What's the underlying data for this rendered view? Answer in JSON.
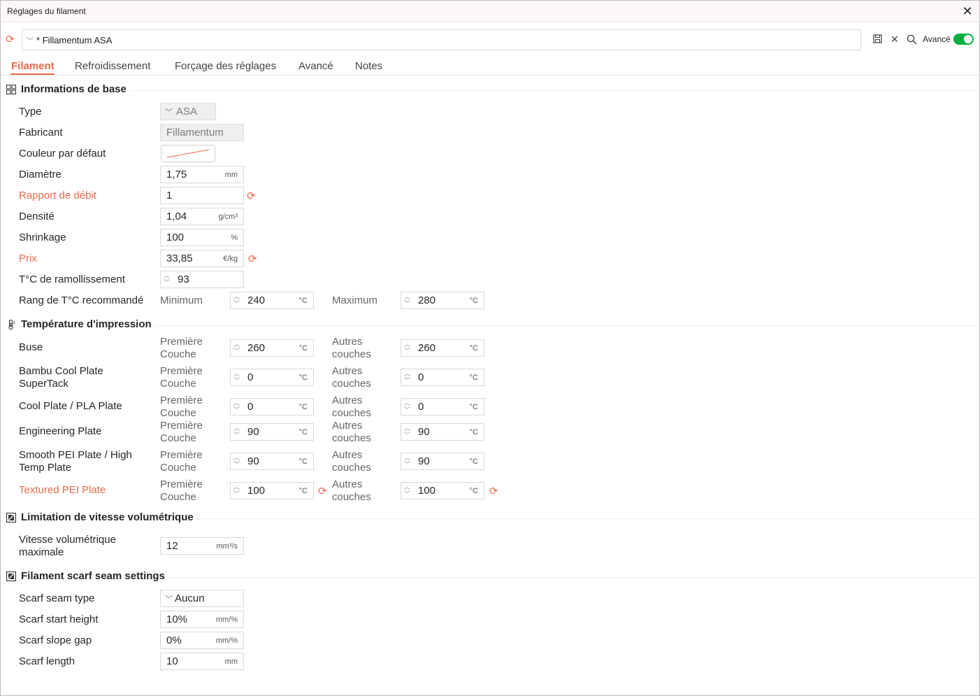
{
  "window": {
    "title": "Réglages du filament"
  },
  "preset": {
    "value": "* Fillamentum ASA",
    "advanced_label": "Avancé"
  },
  "tabs": [
    "Filament",
    "Refroidissement",
    "Forçage des réglages",
    "Avancé",
    "Notes"
  ],
  "colors": {
    "accent": "#e8694a",
    "toggle_on": "#00ae42",
    "swatch_line": "#e8694a"
  },
  "basic": {
    "title": "Informations de base",
    "type": {
      "label": "Type",
      "value": "ASA"
    },
    "vendor": {
      "label": "Fabricant",
      "value": "Fillamentum"
    },
    "color": {
      "label": "Couleur par défaut"
    },
    "diameter": {
      "label": "Diamètre",
      "value": "1,75",
      "unit": "mm"
    },
    "flow": {
      "label": "Rapport de débit",
      "value": "1"
    },
    "density": {
      "label": "Densité",
      "value": "1,04",
      "unit": "g/cm³"
    },
    "shrinkage": {
      "label": "Shrinkage",
      "value": "100",
      "unit": "%"
    },
    "price": {
      "label": "Prix",
      "value": "33,85",
      "unit": "€/kg"
    },
    "softening": {
      "label": "T°C de ramollissement",
      "value": "93"
    },
    "range": {
      "label": "Rang de T°C recommandé",
      "min_label": "Minimum",
      "min": "240",
      "max_label": "Maximum",
      "max": "280",
      "unit": "°C"
    }
  },
  "print_temp": {
    "title": "Température d'impression",
    "first_label": "Première Couche",
    "other_label": "Autres couches",
    "unit": "°C",
    "rows": [
      {
        "label": "Buse",
        "first": "260",
        "other": "260"
      },
      {
        "label": "Bambu Cool Plate SuperTack",
        "first": "0",
        "other": "0"
      },
      {
        "label": "Cool Plate / PLA Plate",
        "first": "0",
        "other": "0"
      },
      {
        "label": "Engineering Plate",
        "first": "90",
        "other": "90"
      },
      {
        "label": "Smooth PEI Plate / High Temp Plate",
        "first": "90",
        "other": "90"
      },
      {
        "label": "Textured PEI Plate",
        "first": "100",
        "other": "100"
      }
    ]
  },
  "volumetric": {
    "title": "Limitation de vitesse volumétrique",
    "label": "Vitesse volumétrique maximale",
    "value": "12",
    "unit": "mm³/s"
  },
  "scarf": {
    "title": "Filament scarf seam settings",
    "type": {
      "label": "Scarf seam type",
      "value": "Aucun"
    },
    "start_height": {
      "label": "Scarf start height",
      "value": "10%",
      "unit": "mm/%"
    },
    "slope_gap": {
      "label": "Scarf slope gap",
      "value": "0%",
      "unit": "mm/%"
    },
    "length": {
      "label": "Scarf length",
      "value": "10",
      "unit": "mm"
    }
  }
}
